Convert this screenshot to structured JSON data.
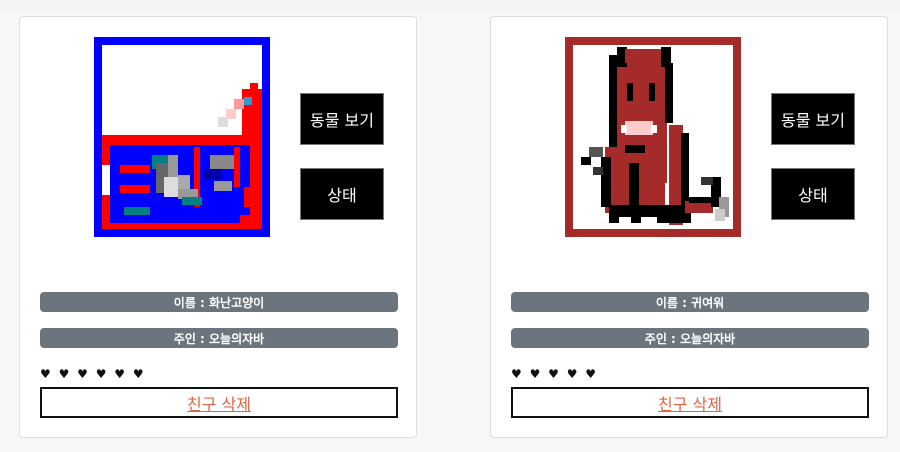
{
  "cards": [
    {
      "image": "pixel-art-angry-cat",
      "view_label": "동물 보기",
      "status_label": "상태",
      "name_text": "이름 : 화난고양이",
      "owner_text": "주인 : 오늘의자바",
      "hearts": "♥ ♥ ♥ ♥ ♥ ♥",
      "delete_label": "친구 삭제"
    },
    {
      "image": "pixel-art-cute-cat",
      "view_label": "동물 보기",
      "status_label": "상태",
      "name_text": "이름 : 귀여워",
      "owner_text": "주인 : 오늘의자바",
      "hearts": "♥ ♥ ♥ ♥ ♥",
      "delete_label": "친구 삭제"
    }
  ],
  "colors": {
    "button_bg": "#000000",
    "pill_bg": "#6c757d",
    "delete_text": "#e06443",
    "frame_blue": "#0000ff",
    "frame_brown": "#a52a2a"
  }
}
